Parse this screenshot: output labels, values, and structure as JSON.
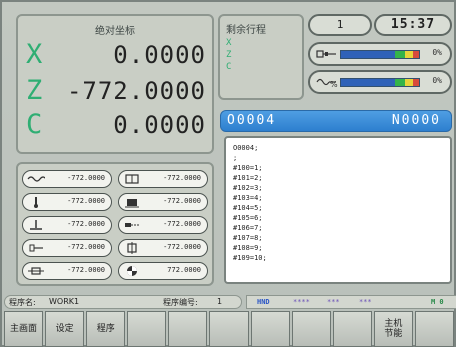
{
  "coordinates": {
    "title": "绝对坐标",
    "axes": [
      {
        "letter": "X",
        "value": "0.0000"
      },
      {
        "letter": "Z",
        "value": "-772.0000"
      },
      {
        "letter": "C",
        "value": "0.0000"
      }
    ]
  },
  "remaining": {
    "title": "剩余行程",
    "axes": [
      "X",
      "Z",
      "C"
    ]
  },
  "top_status": {
    "number": "1",
    "time": "15:37"
  },
  "rates": [
    {
      "icon": "spindle-rate-icon",
      "percent": "0%"
    },
    {
      "icon": "feed-rate-icon",
      "percent": "0%"
    }
  ],
  "program": {
    "number": "O0004",
    "sequence": "N0000",
    "lines": [
      "O0004;",
      ";",
      "#100=1;",
      "#101=2;",
      "#102=3;",
      "#103=4;",
      "#104=5;",
      "#105=6;",
      "#106=7;",
      "#107=8;",
      "#108=9;",
      "#109=10;"
    ]
  },
  "tools": [
    {
      "icon": "wave-icon",
      "value": "-772.0000"
    },
    {
      "icon": "coolant-icon",
      "value": "-772.0000"
    },
    {
      "icon": "chuck-icon",
      "value": "-772.0000"
    },
    {
      "icon": "lubricate-icon",
      "value": "-772.0000"
    },
    {
      "icon": "tool-down-icon",
      "value": "-772.0000"
    },
    {
      "icon": "tool-side-icon",
      "value": "-772.0000"
    },
    {
      "icon": "tailstock-icon",
      "value": "-772.0000"
    },
    {
      "icon": "turret-icon",
      "value": "-772.0000"
    },
    {
      "icon": "clamp-icon",
      "value": "-772.0000"
    },
    {
      "icon": "spindle-icon",
      "value": "772.0000"
    }
  ],
  "status": {
    "program_name_label": "程序名:",
    "program_name": "WORK1",
    "program_count_label": "程序编号:",
    "program_count": "1",
    "mode": "HND",
    "ind1": "****",
    "ind2": "***",
    "ind3": "***",
    "right": "M 0"
  },
  "softkeys": [
    "主画面",
    "设定",
    "程序",
    "",
    "",
    "",
    "",
    "",
    "",
    "主机\n节能",
    ""
  ],
  "colors": {
    "axis_letter": "#2fae73",
    "header_blue": "#2d7fcf",
    "bar_blue": "#2f62b8"
  }
}
